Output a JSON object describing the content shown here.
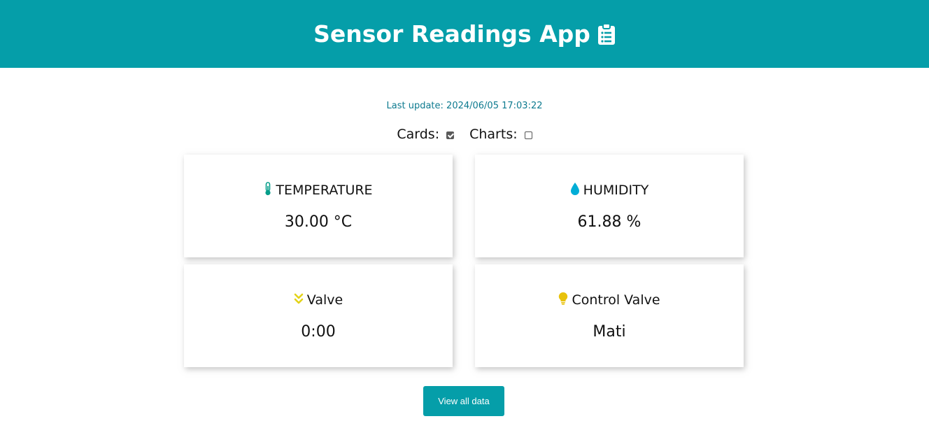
{
  "header": {
    "title": "Sensor Readings App",
    "icon": "clipboard-icon"
  },
  "last_update": {
    "label": "Last update:",
    "value": "2024/06/05 17:03:22"
  },
  "toggles": {
    "cards_label": "Cards:",
    "cards_checked": true,
    "charts_label": "Charts:",
    "charts_checked": false
  },
  "cards": [
    {
      "title": "TEMPERATURE",
      "value": "30.00 °C",
      "icon": "thermometer-icon",
      "icon_color": "#059e8a"
    },
    {
      "title": "HUMIDITY",
      "value": "61.88 %",
      "icon": "water-drop-icon",
      "icon_color": "#00add6"
    },
    {
      "title": "Valve",
      "value": "0:00",
      "icon": "double-chevron-down-icon",
      "icon_color": "#e3d319"
    },
    {
      "title": "Control Valve",
      "value": "Mati",
      "icon": "lightbulb-icon",
      "icon_color": "#e8c20c"
    }
  ],
  "button": {
    "label": "View all data"
  },
  "colors": {
    "brand": "#059ea9",
    "update_text": "#0d7a8f"
  }
}
